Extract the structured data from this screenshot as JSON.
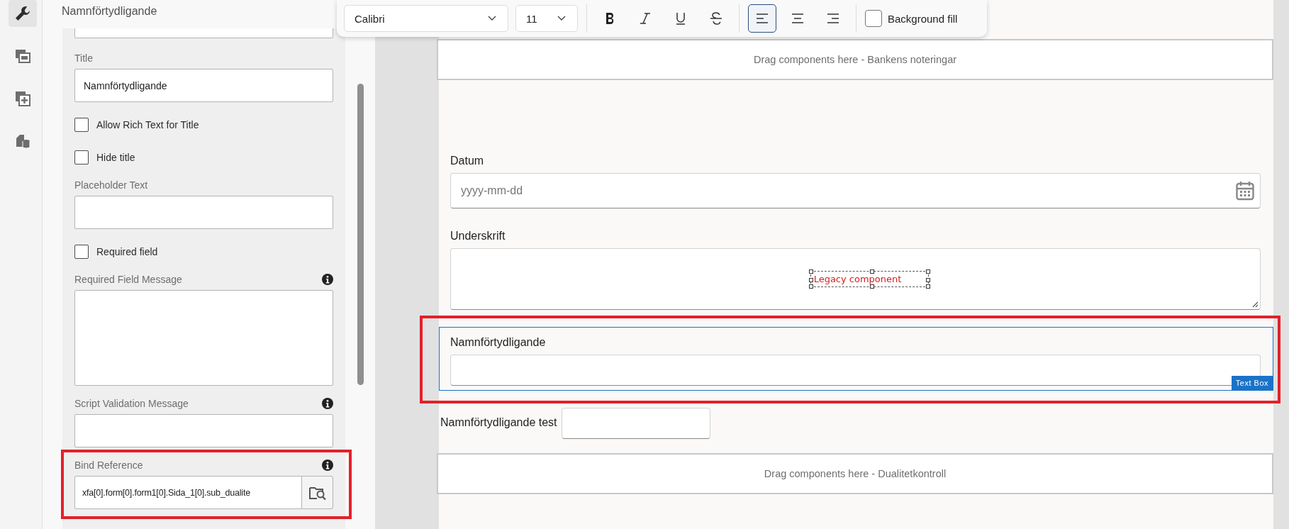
{
  "side_rail": {
    "items": [
      {
        "kind": "wrench",
        "selected": true
      },
      {
        "kind": "media",
        "selected": false
      },
      {
        "kind": "add",
        "selected": false
      },
      {
        "kind": "data",
        "selected": false
      }
    ]
  },
  "properties_panel": {
    "title": "Namnförtydligande",
    "fields": [
      {
        "kind": "partial"
      },
      {
        "kind": "text",
        "label": "Title",
        "value": "Namnförtydligande"
      },
      {
        "kind": "checkbox",
        "label": "Allow Rich Text for Title",
        "checked": false
      },
      {
        "kind": "checkbox",
        "label": "Hide title",
        "checked": false
      },
      {
        "kind": "text",
        "label": "Placeholder Text"
      },
      {
        "kind": "checkbox",
        "label": "Required field",
        "checked": false
      },
      {
        "kind": "textarea",
        "label": "Required Field Message",
        "info": true
      },
      {
        "kind": "text",
        "label": "Script Validation Message",
        "info": true
      },
      {
        "kind": "browse",
        "label": "Bind Reference",
        "value": "xfa[0].form[0].form1[0].Sida_1[0].sub_dualite",
        "info": true,
        "highlighted": true
      }
    ]
  },
  "toolbar": {
    "font": "Calibri",
    "size": "11",
    "format_buttons": [
      {
        "kind": "bold",
        "selected": false
      },
      {
        "kind": "italic",
        "selected": false
      },
      {
        "kind": "underline",
        "selected": false
      },
      {
        "kind": "strike",
        "selected": false
      }
    ],
    "align_buttons": [
      {
        "kind": "left",
        "selected": true
      },
      {
        "kind": "center",
        "selected": false
      },
      {
        "kind": "right",
        "selected": false
      }
    ],
    "background_fill": {
      "label": "Background fill",
      "checked": false
    }
  },
  "form": {
    "items": [
      {
        "kind": "dropzone",
        "text": "Drag components here - Bankens noteringar"
      },
      {
        "kind": "date",
        "label": "Datum",
        "placeholder": "yyyy-mm-dd"
      },
      {
        "kind": "signature",
        "label": "Underskrift",
        "legacy_text": "Legacy component"
      },
      {
        "kind": "textbox",
        "label": "Namnförtydligande",
        "selected": true,
        "badge": "Text Box",
        "highlighted": true
      },
      {
        "kind": "inline",
        "label": "Namnförtydligande test"
      },
      {
        "kind": "dropzone",
        "text": "Drag components here - Dualitetkontroll"
      }
    ]
  }
}
